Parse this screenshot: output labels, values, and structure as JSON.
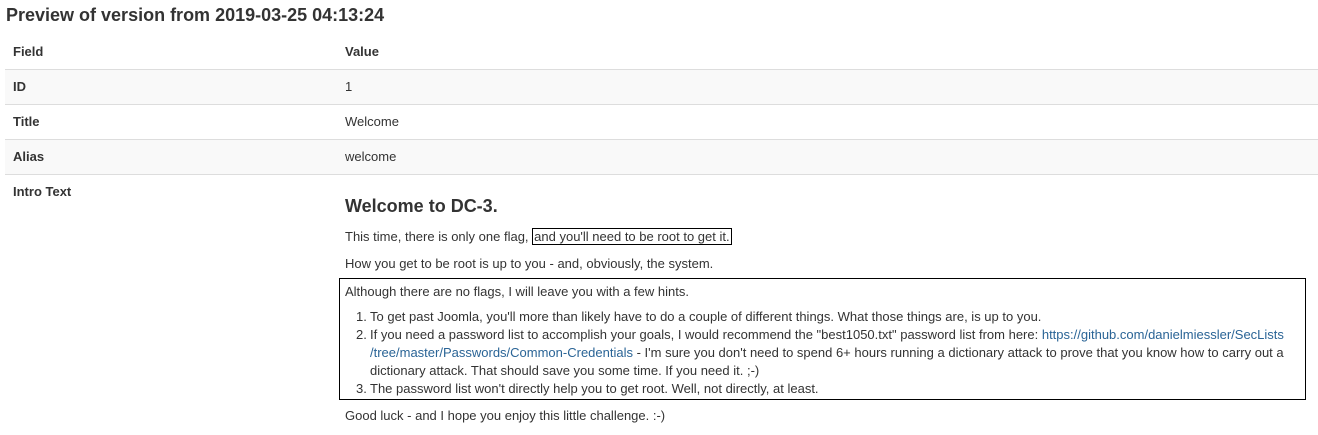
{
  "page": {
    "title": "Preview of version from 2019-03-25 04:13:24"
  },
  "table": {
    "header": {
      "field": "Field",
      "value": "Value"
    },
    "rows": [
      {
        "field": "ID",
        "value": "1"
      },
      {
        "field": "Title",
        "value": "Welcome"
      },
      {
        "field": "Alias",
        "value": "welcome"
      }
    ],
    "intro": {
      "field": "Intro Text",
      "heading": "Welcome to DC-3.",
      "p1_text": "This time, there is only one flag,",
      "p1_boxed": "and you'll need to be root to get it.",
      "p2": "How you get to be root is up to you - and, obviously, the system.",
      "hints_intro": "Although there are no flags, I will leave you with a few hints.",
      "hints": [
        {
          "num": "1.",
          "text": "To get past Joomla, you'll more than likely have to do a couple of different things.  What those things are, is up to you."
        },
        {
          "num": "2.",
          "text_before": "If you need a password list to accomplish your goals, I would recommend the \"best1050.txt\" password list from here: ",
          "link_part1": "https://github.com/danielmiessler/SecLists",
          "link_part2": "/tree/master/Passwords/Common-Credentials",
          "text_after": " - I'm sure you don't need to spend 6+ hours running a dictionary attack to prove that you know how to carry out a dictionary attack.  That should save you some time.  If you need it.  ;-)"
        },
        {
          "num": "3.",
          "text": "The password list won't directly help you to get root.  Well, not directly, at least."
        }
      ],
      "closing": "Good luck - and I hope you enjoy this little challenge.  :-)"
    }
  },
  "colors": {
    "text": "#333333",
    "link": "#2a6496",
    "row_stripe": "#f9f9f9",
    "border": "#dddddd"
  }
}
